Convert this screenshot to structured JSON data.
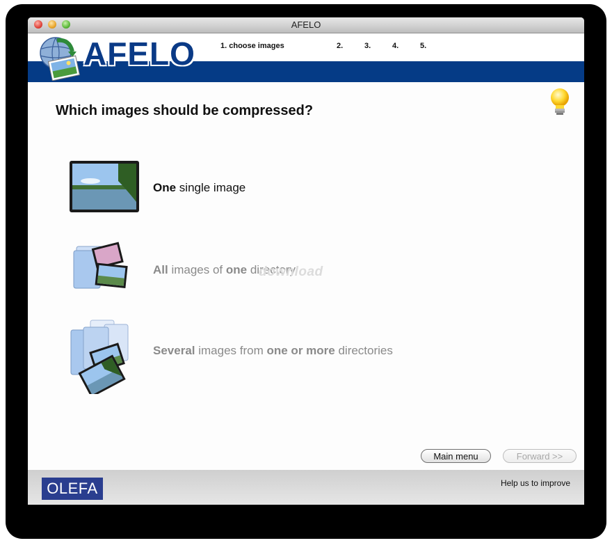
{
  "window": {
    "title": "AFELO"
  },
  "header": {
    "logo_text": "AFELO",
    "steps": [
      {
        "label": "1. choose images",
        "active": true
      },
      {
        "label": "2.",
        "active": false
      },
      {
        "label": "3.",
        "active": false
      },
      {
        "label": "4.",
        "active": false
      },
      {
        "label": "5.",
        "active": false
      }
    ],
    "accent_color": "#053b86"
  },
  "main": {
    "question": "Which images should be compressed?",
    "options": [
      {
        "bold1": "One",
        "rest1": " single image",
        "enabled": true
      },
      {
        "bold1": "All",
        "rest1": " images of ",
        "bold2": "one",
        "rest2": " directory",
        "enabled": false
      },
      {
        "bold1": "Several",
        "rest1": " images from ",
        "bold2": "one or more",
        "rest2": " directories",
        "enabled": false
      }
    ],
    "watermark": "download"
  },
  "buttons": {
    "main_menu": "Main menu",
    "forward": "Forward >>"
  },
  "footer": {
    "brand": "OLEFA",
    "help_link": "Help us to improve"
  }
}
